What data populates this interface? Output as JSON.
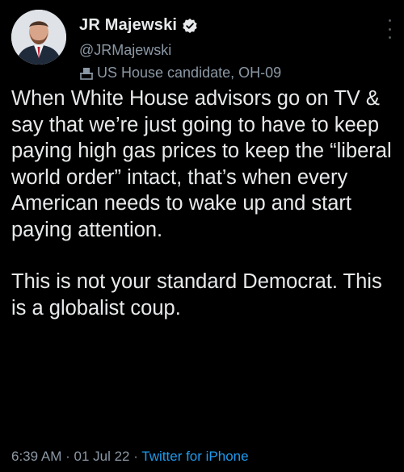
{
  "author": {
    "display_name": "JR Majewski",
    "handle": "@JRMajewski",
    "verified_icon": "verified-badge-icon",
    "label_icon": "ballot-box-icon",
    "label": "US House candidate, OH-09"
  },
  "tweet": {
    "paragraph_1": "When White House advisors go on TV & say that we’re just going to have to keep paying high gas prices to keep the “liberal world order” intact, that’s when every American needs to wake up and start paying attention.",
    "paragraph_2": "This is not your standard Democrat. This is a globalist coup."
  },
  "meta": {
    "time": "6:39 AM",
    "separator_1": " · ",
    "date": "01 Jul 22",
    "separator_2": " · ",
    "source": "Twitter for iPhone"
  },
  "colors": {
    "background": "#000000",
    "text": "#e7e9ea",
    "secondary": "#8b98a5",
    "link": "#1d9bf0"
  }
}
